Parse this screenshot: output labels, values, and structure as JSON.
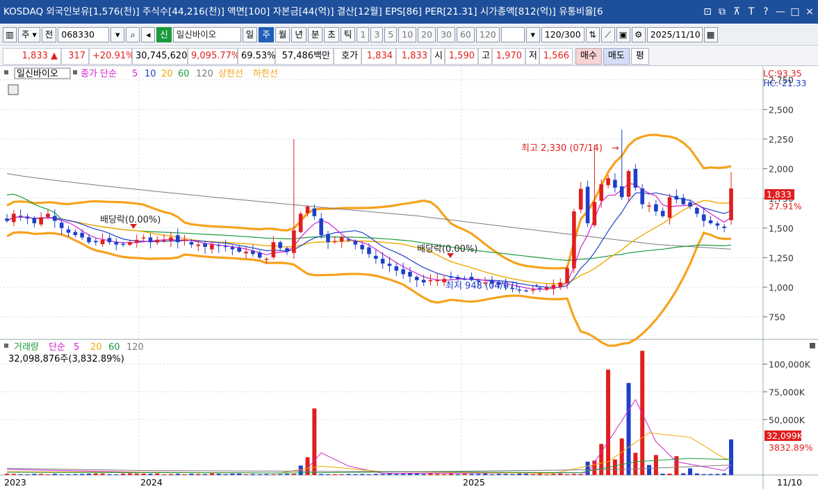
{
  "titlebar": {
    "text": "KOSDAQ 외국인보유[1,576(천)] 주식수[44,216(천)] 액면[100] 자본금[44(억)] 결산[12월] EPS[86] PER[21.31] 시가총액[812(억)] 유통비율[6",
    "icons": [
      "restore-icon",
      "popout-icon",
      "pin-icon",
      "font-icon",
      "help-icon",
      "minimize-icon",
      "maximize-icon",
      "close-icon"
    ],
    "icon_glyphs": [
      "⊡",
      "⧉",
      "⊼",
      "T",
      "?",
      "—",
      "□",
      "×"
    ]
  },
  "toolbar": {
    "period_prefix": "주",
    "period_prefix2": "전",
    "code": "068330",
    "new_badge": "신",
    "stock_name": "일신바이오",
    "periods": [
      "일",
      "주",
      "월",
      "년",
      "분",
      "초",
      "틱"
    ],
    "active_period": "주",
    "intervals": [
      "1",
      "3",
      "5",
      "10",
      "20",
      "30",
      "60",
      "120"
    ],
    "count_value": "120",
    "count_total": "/300",
    "date": "2025/11/10"
  },
  "quote": {
    "price": "1,833",
    "change": "317",
    "change_pct": "+20.91%",
    "volume": "30,745,620",
    "volume_ratio": "9,095.77%",
    "turnover": "69.53%",
    "amount": "57,486백만",
    "ask_label": "호가",
    "ask1": "1,834",
    "ask2": "1,833",
    "open_label": "시",
    "open": "1,590",
    "high_label": "고",
    "high": "1,970",
    "low_label": "저",
    "low": "1,566",
    "buy_label": "매수",
    "sell_label": "매도",
    "eval_label": "평"
  },
  "legend_price": {
    "name": "일신바이오",
    "ma_label": "종가 단순",
    "ma_periods": [
      "5",
      "10",
      "20",
      "60",
      "120"
    ],
    "upper": "상한선",
    "lower": "하한선",
    "lc": "LC:93.35",
    "hc": "HC:-21.33"
  },
  "legend_volume": {
    "name": "거래량",
    "ma_label": "단순",
    "ma_periods": [
      "5",
      "20",
      "60",
      "120"
    ],
    "current": "32,098,876주(3,832.89%)"
  },
  "annotations": {
    "high_note": "최고 2,330 (07/14)",
    "low_note": "최저 948 (04/07)",
    "dividend1": "배당락(0.00%)",
    "dividend2": "배당락(0.00%)",
    "last_price_tag": "1,833",
    "last_pct_tag": "27.91%",
    "last_vol_tag": "32,099K",
    "last_vol_pct": "3832.89%"
  },
  "x_axis": {
    "labels": [
      "2023",
      "2024",
      "2025"
    ],
    "last_date": "11/10"
  },
  "colors": {
    "up": "#e01e1e",
    "down": "#1d40c8",
    "ma5": "#d020d0",
    "ma10": "#1d40c8",
    "ma20": "#f0a800",
    "ma60": "#1a9a3a",
    "ma120": "#7a7a7a",
    "envelope": "#f6a21d"
  },
  "chart_data": [
    {
      "type": "candlestick",
      "title": "일신바이오",
      "y_ticks": [
        750,
        1000,
        1250,
        1500,
        1750,
        2000,
        2250,
        2500,
        2750
      ],
      "ylim": [
        560,
        2860
      ],
      "x_ticks": [
        "2023",
        "2024",
        "2025"
      ],
      "series_names": [
        "종가 단순 5",
        "10",
        "20",
        "60",
        "120",
        "상한선",
        "하한선"
      ],
      "candles_weekly_close_approx": [
        1560,
        1620,
        1600,
        1580,
        1540,
        1590,
        1620,
        1560,
        1500,
        1460,
        1440,
        1420,
        1380,
        1380,
        1400,
        1380,
        1360,
        1360,
        1380,
        1400,
        1420,
        1380,
        1400,
        1400,
        1420,
        1380,
        1400,
        1360,
        1360,
        1340,
        1360,
        1350,
        1340,
        1320,
        1300,
        1300,
        1280,
        1250,
        1240,
        1380,
        1330,
        1300,
        1480,
        1620,
        1680,
        1600,
        1440,
        1380,
        1390,
        1420,
        1400,
        1360,
        1320,
        1280,
        1240,
        1200,
        1180,
        1140,
        1110,
        1090,
        1060,
        1040,
        1060,
        1060,
        1070,
        1080,
        1070,
        1070,
        1060,
        1050,
        1040,
        1030,
        1020,
        1010,
        990,
        980,
        970,
        980,
        990,
        1000,
        1020,
        1040,
        1160,
        1640,
        1830,
        1540,
        1720,
        1870,
        1920,
        1840,
        1760,
        1980,
        1840,
        1700,
        1690,
        1640,
        1600,
        1760,
        1740,
        1700,
        1680,
        1620,
        1560,
        1540,
        1520,
        1500,
        1833
      ],
      "high": {
        "value": 2330,
        "label": "최고 2,330 (07/14)"
      },
      "low": {
        "value": 948,
        "label": "최저 948 (04/07)"
      },
      "last": {
        "value": 1833,
        "pct": "27.91%"
      }
    },
    {
      "type": "bar",
      "title": "거래량",
      "y_ticks": [
        "100,000K",
        "75,000K",
        "50,000K"
      ],
      "ylim": [
        0,
        116000
      ],
      "last": {
        "value": 32099,
        "label": "32,099K",
        "pct": "3832.89%"
      }
    }
  ]
}
